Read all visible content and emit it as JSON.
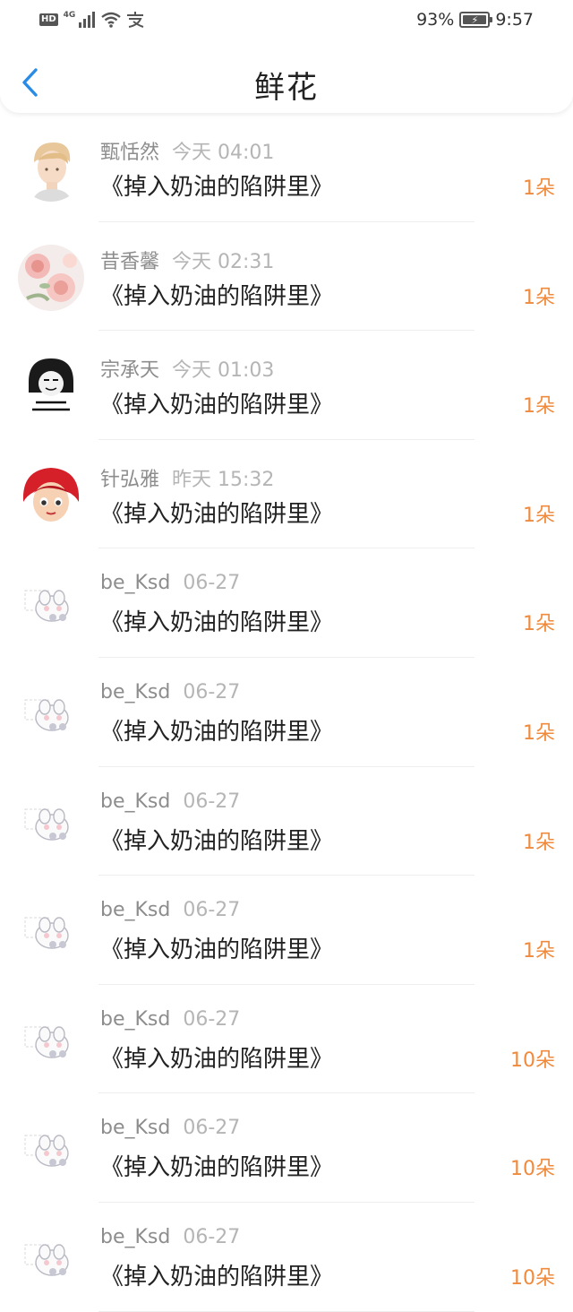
{
  "status_bar": {
    "left": {
      "hd": "HD",
      "network": "4G",
      "icons": [
        "signal-icon",
        "wifi-icon",
        "alipay-icon"
      ]
    },
    "battery": "93%",
    "time": "9:57"
  },
  "header": {
    "title": "鲜花",
    "back_icon": "chevron-left-icon"
  },
  "colors": {
    "accent_blue": "#2a8be6",
    "count_orange": "#f08a3c",
    "name_gray": "#8d8d8d",
    "time_gray": "#b5b5b5"
  },
  "rows": [
    {
      "name": "甄恬然",
      "time": "今天 04:01",
      "book": "《掉入奶油的陷阱里》",
      "count": "1朵",
      "avatar": "avatar-anime-boy"
    },
    {
      "name": "昔香馨",
      "time": "今天 02:31",
      "book": "《掉入奶油的陷阱里》",
      "count": "1朵",
      "avatar": "avatar-flowers"
    },
    {
      "name": "宗承天",
      "time": "今天 01:03",
      "book": "《掉入奶油的陷阱里》",
      "count": "1朵",
      "avatar": "avatar-meme"
    },
    {
      "name": "针弘雅",
      "time": "昨天 15:32",
      "book": "《掉入奶油的陷阱里》",
      "count": "1朵",
      "avatar": "avatar-redhair-girl"
    },
    {
      "name": "be_Ksd",
      "time": "06-27",
      "book": "《掉入奶油的陷阱里》",
      "count": "1朵",
      "avatar": "avatar-default"
    },
    {
      "name": "be_Ksd",
      "time": "06-27",
      "book": "《掉入奶油的陷阱里》",
      "count": "1朵",
      "avatar": "avatar-default"
    },
    {
      "name": "be_Ksd",
      "time": "06-27",
      "book": "《掉入奶油的陷阱里》",
      "count": "1朵",
      "avatar": "avatar-default"
    },
    {
      "name": "be_Ksd",
      "time": "06-27",
      "book": "《掉入奶油的陷阱里》",
      "count": "1朵",
      "avatar": "avatar-default"
    },
    {
      "name": "be_Ksd",
      "time": "06-27",
      "book": "《掉入奶油的陷阱里》",
      "count": "10朵",
      "avatar": "avatar-default"
    },
    {
      "name": "be_Ksd",
      "time": "06-27",
      "book": "《掉入奶油的陷阱里》",
      "count": "10朵",
      "avatar": "avatar-default"
    },
    {
      "name": "be_Ksd",
      "time": "06-27",
      "book": "《掉入奶油的陷阱里》",
      "count": "10朵",
      "avatar": "avatar-default"
    }
  ]
}
